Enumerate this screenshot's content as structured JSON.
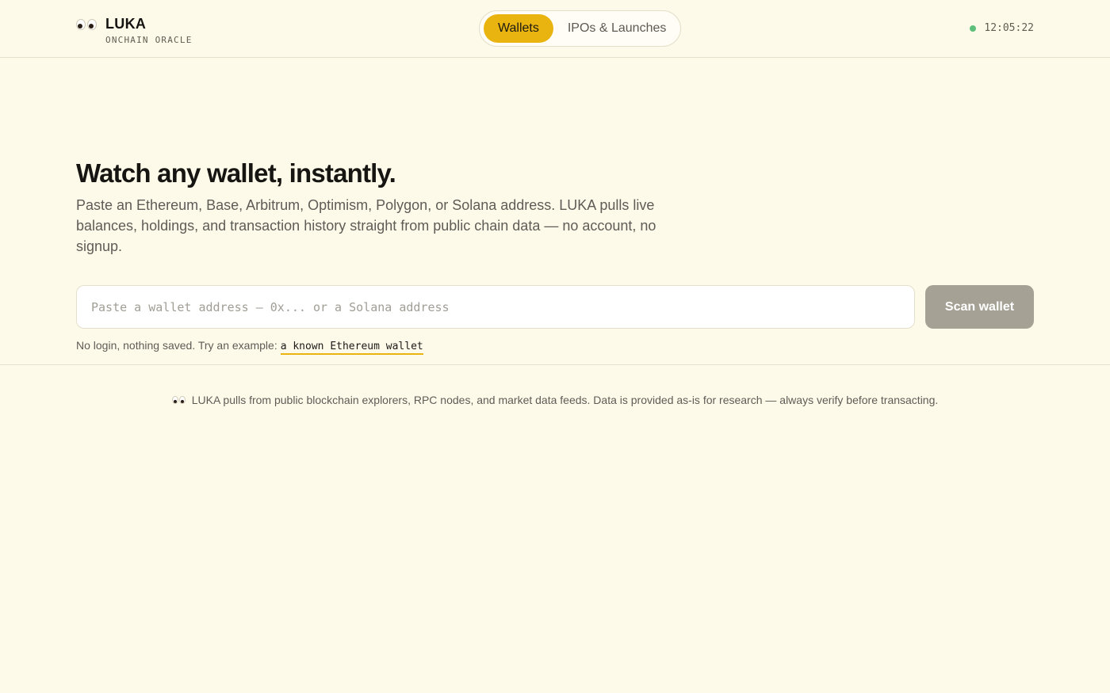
{
  "brand": {
    "icon": "eyes-icon",
    "name": "LUKA",
    "tagline": "ONCHAIN ORACLE"
  },
  "nav": {
    "tabs": [
      {
        "label": "Wallets",
        "active": true
      },
      {
        "label": "IPOs & Launches",
        "active": false
      }
    ]
  },
  "status": {
    "indicator_color": "#5fbf7a",
    "time": "12:05:22"
  },
  "hero": {
    "title": "Watch any wallet, instantly.",
    "subtitle": "Paste an Ethereum, Base, Arbitrum, Optimism, Polygon, or Solana address. LUKA pulls live balances, holdings, and transaction history straight from public chain data — no account, no signup."
  },
  "search": {
    "value": "",
    "placeholder": "Paste a wallet address — 0x... or a Solana address",
    "button_label": "Scan wallet"
  },
  "hint": {
    "text": "No login, nothing saved. Try an example:",
    "example_link": "a known Ethereum wallet"
  },
  "footer": {
    "icon": "eyes-icon",
    "text": "LUKA pulls from public blockchain explorers, RPC nodes, and market data feeds. Data is provided as-is for research — always verify before transacting."
  },
  "colors": {
    "background": "#fefae9",
    "accent": "#e9b410",
    "button_disabled": "#a5a195"
  }
}
